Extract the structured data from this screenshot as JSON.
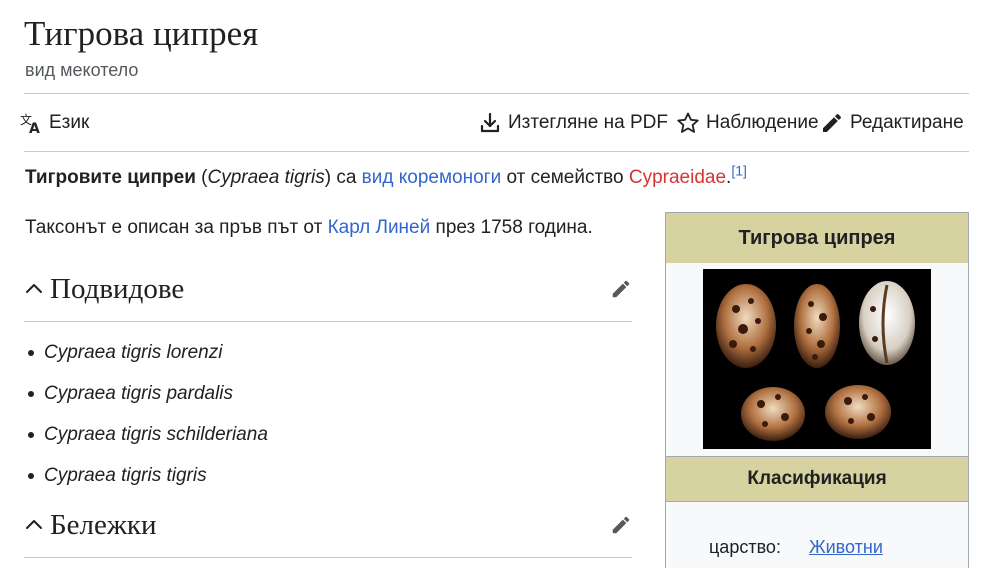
{
  "page": {
    "title": "Тигрова ципрея",
    "subtitle": "вид мекотело"
  },
  "toolbar": {
    "language": {
      "label": "Език",
      "icon": "translate-icon"
    },
    "download": {
      "label": "Изтегляне на PDF",
      "icon": "download-icon"
    },
    "watch": {
      "label": "Наблюдение",
      "icon": "star-icon"
    },
    "edit": {
      "label": "Редактиране",
      "icon": "pencil-icon"
    }
  },
  "lead": {
    "bold_name": "Тигровите ципреи",
    "open_paren": " (",
    "latin": "Cypraea tigris",
    "close_paren_sa": ") са ",
    "link_species": "вид",
    "space1": " ",
    "link_gastropods": "коремоноги",
    "mid": " от семейство ",
    "link_family": "Cypraeidae",
    "dot": ".",
    "ref": "[1]"
  },
  "para": {
    "before": "Таксонът е описан за пръв път от ",
    "link_linnaeus": "Карл Линей",
    "after": " през 1758 година."
  },
  "sections": {
    "subspecies": {
      "heading": "Подвидове"
    },
    "notes": {
      "heading": "Бележки"
    }
  },
  "subspecies": [
    "Cypraea tigris lorenzi",
    "Cypraea tigris pardalis",
    "Cypraea tigris schilderiana",
    "Cypraea tigris tigris"
  ],
  "infobox": {
    "title": "Тигрова ципрея",
    "classification_heading": "Класификация",
    "rows": [
      {
        "key": "царство:",
        "value": "Животни"
      }
    ],
    "header_color": "#d6d3a0"
  },
  "colors": {
    "link": "#3366cc",
    "redlink": "#d73333",
    "text": "#202122"
  }
}
